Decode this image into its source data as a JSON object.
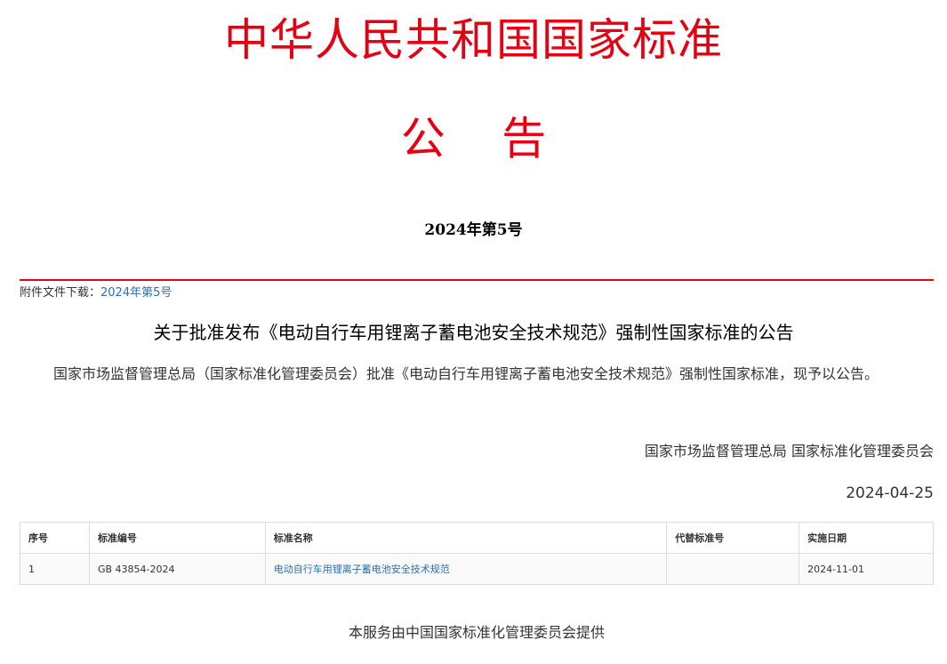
{
  "header": {
    "title": "中华人民共和国国家标准",
    "subtitle": "公    告",
    "doc_number": "2024年第5号"
  },
  "attachment": {
    "label": "附件文件下载：",
    "link_text": "2024年第5号"
  },
  "notice": {
    "title": "关于批准发布《电动自行车用锂离子蓄电池安全技术规范》强制性国家标准的公告",
    "body": "国家市场监督管理总局（国家标准化管理委员会）批准《电动自行车用锂离子蓄电池安全技术规范》强制性国家标准，现予以公告。",
    "issuer": "国家市场监督管理总局 国家标准化管理委员会",
    "date": "2024-04-25"
  },
  "table": {
    "headers": [
      "序号",
      "标准编号",
      "标准名称",
      "代替标准号",
      "实施日期"
    ],
    "rows": [
      [
        "1",
        "GB 43854-2024",
        "电动自行车用锂离子蓄电池安全技术规范",
        "",
        "2024-11-01"
      ]
    ]
  },
  "footer": {
    "text": "本服务由中国国家标准化管理委员会提供"
  },
  "colors": {
    "accent_red": "#e60012",
    "link_blue": "#2a6fb3"
  }
}
